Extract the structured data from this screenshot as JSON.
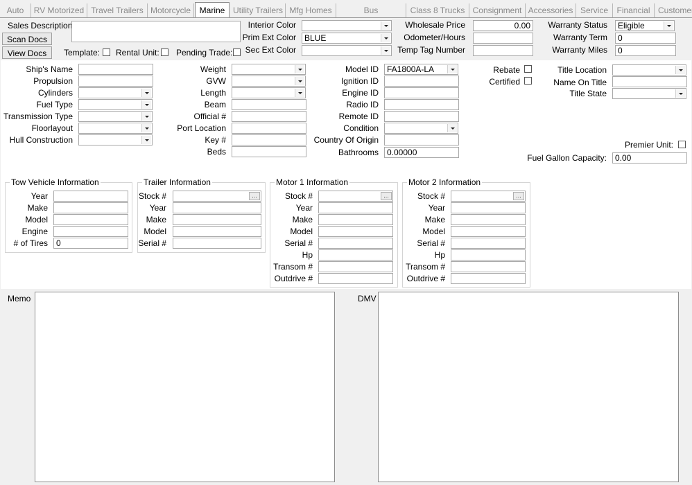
{
  "tabs": [
    {
      "label": "Auto",
      "active": false
    },
    {
      "label": "RV Motorized",
      "active": false
    },
    {
      "label": "Travel Trailers",
      "active": false
    },
    {
      "label": "Motorcycle",
      "active": false
    },
    {
      "label": "Marine",
      "active": true
    },
    {
      "label": "Utility Trailers",
      "active": false
    },
    {
      "label": "Mfg Homes",
      "active": false
    },
    {
      "label": "Bus",
      "active": false
    },
    {
      "label": "Class 8 Trucks",
      "active": false
    },
    {
      "label": "Consignment",
      "active": false
    },
    {
      "label": "Accessories",
      "active": false
    },
    {
      "label": "Service",
      "active": false
    },
    {
      "label": "Financial",
      "active": false
    },
    {
      "label": "Customer",
      "active": false
    }
  ],
  "header": {
    "sales_description_label": "Sales Description",
    "sales_description_value": "",
    "scan_docs_label": "Scan Docs",
    "view_docs_label": "View Docs",
    "template_label": "Template:",
    "rental_unit_label": "Rental Unit:",
    "pending_trade_label": "Pending Trade:",
    "interior_color_label": "Interior Color",
    "interior_color_value": "",
    "prim_ext_color_label": "Prim Ext Color",
    "prim_ext_color_value": "BLUE",
    "sec_ext_color_label": "Sec Ext Color",
    "sec_ext_color_value": "",
    "wholesale_price_label": "Wholesale Price",
    "wholesale_price_value": "0.00",
    "odometer_label": "Odometer/Hours",
    "odometer_value": "",
    "temp_tag_label": "Temp Tag Number",
    "temp_tag_value": "",
    "warranty_status_label": "Warranty Status",
    "warranty_status_value": "Eligible",
    "warranty_term_label": "Warranty Term",
    "warranty_term_value": "0",
    "warranty_miles_label": "Warranty Miles",
    "warranty_miles_value": "0"
  },
  "col1": {
    "ships_name": "Ship's Name",
    "propulsion": "Propulsion",
    "cylinders": "Cylinders",
    "fuel_type": "Fuel Type",
    "transmission_type": "Transmission Type",
    "floorlayout": "Floorlayout",
    "hull_construction": "Hull Construction"
  },
  "col2": {
    "weight": "Weight",
    "gvw": "GVW",
    "length": "Length",
    "beam": "Beam",
    "official": "Official #",
    "port_location": "Port Location",
    "key": "Key #",
    "beds": "Beds"
  },
  "col3": {
    "model_id": "Model ID",
    "model_id_value": "FA1800A-LA",
    "ignition_id": "Ignition ID",
    "engine_id": "Engine ID",
    "radio_id": "Radio ID",
    "remote_id": "Remote ID",
    "condition": "Condition",
    "country_of_origin": "Country Of Origin",
    "bathrooms": "Bathrooms",
    "bathrooms_value": "0.00000"
  },
  "col4": {
    "rebate": "Rebate",
    "certified": "Certified"
  },
  "col5": {
    "title_location": "Title Location",
    "name_on_title": "Name On Title",
    "title_state": "Title State",
    "premier_unit": "Premier Unit:",
    "fuel_gallon_capacity": "Fuel Gallon Capacity:",
    "fuel_gallon_capacity_value": "0.00"
  },
  "tow_vehicle": {
    "title": "Tow Vehicle Information",
    "year": "Year",
    "make": "Make",
    "model": "Model",
    "engine": "Engine",
    "tires": "# of Tires",
    "tires_value": "0"
  },
  "trailer": {
    "title": "Trailer Information",
    "stock": "Stock #",
    "year": "Year",
    "make": "Make",
    "model": "Model",
    "serial": "Serial #"
  },
  "motor1": {
    "title": "Motor 1 Information",
    "stock": "Stock #",
    "year": "Year",
    "make": "Make",
    "model": "Model",
    "serial": "Serial #",
    "hp": "Hp",
    "transom": "Transom #",
    "outdrive": "Outdrive #"
  },
  "motor2": {
    "title": "Motor 2 Information",
    "stock": "Stock #",
    "year": "Year",
    "make": "Make",
    "model": "Model",
    "serial": "Serial #",
    "hp": "Hp",
    "transom": "Transom #",
    "outdrive": "Outdrive #"
  },
  "memo_label": "Memo",
  "dmv_label": "DMV",
  "browse_glyph": "..."
}
